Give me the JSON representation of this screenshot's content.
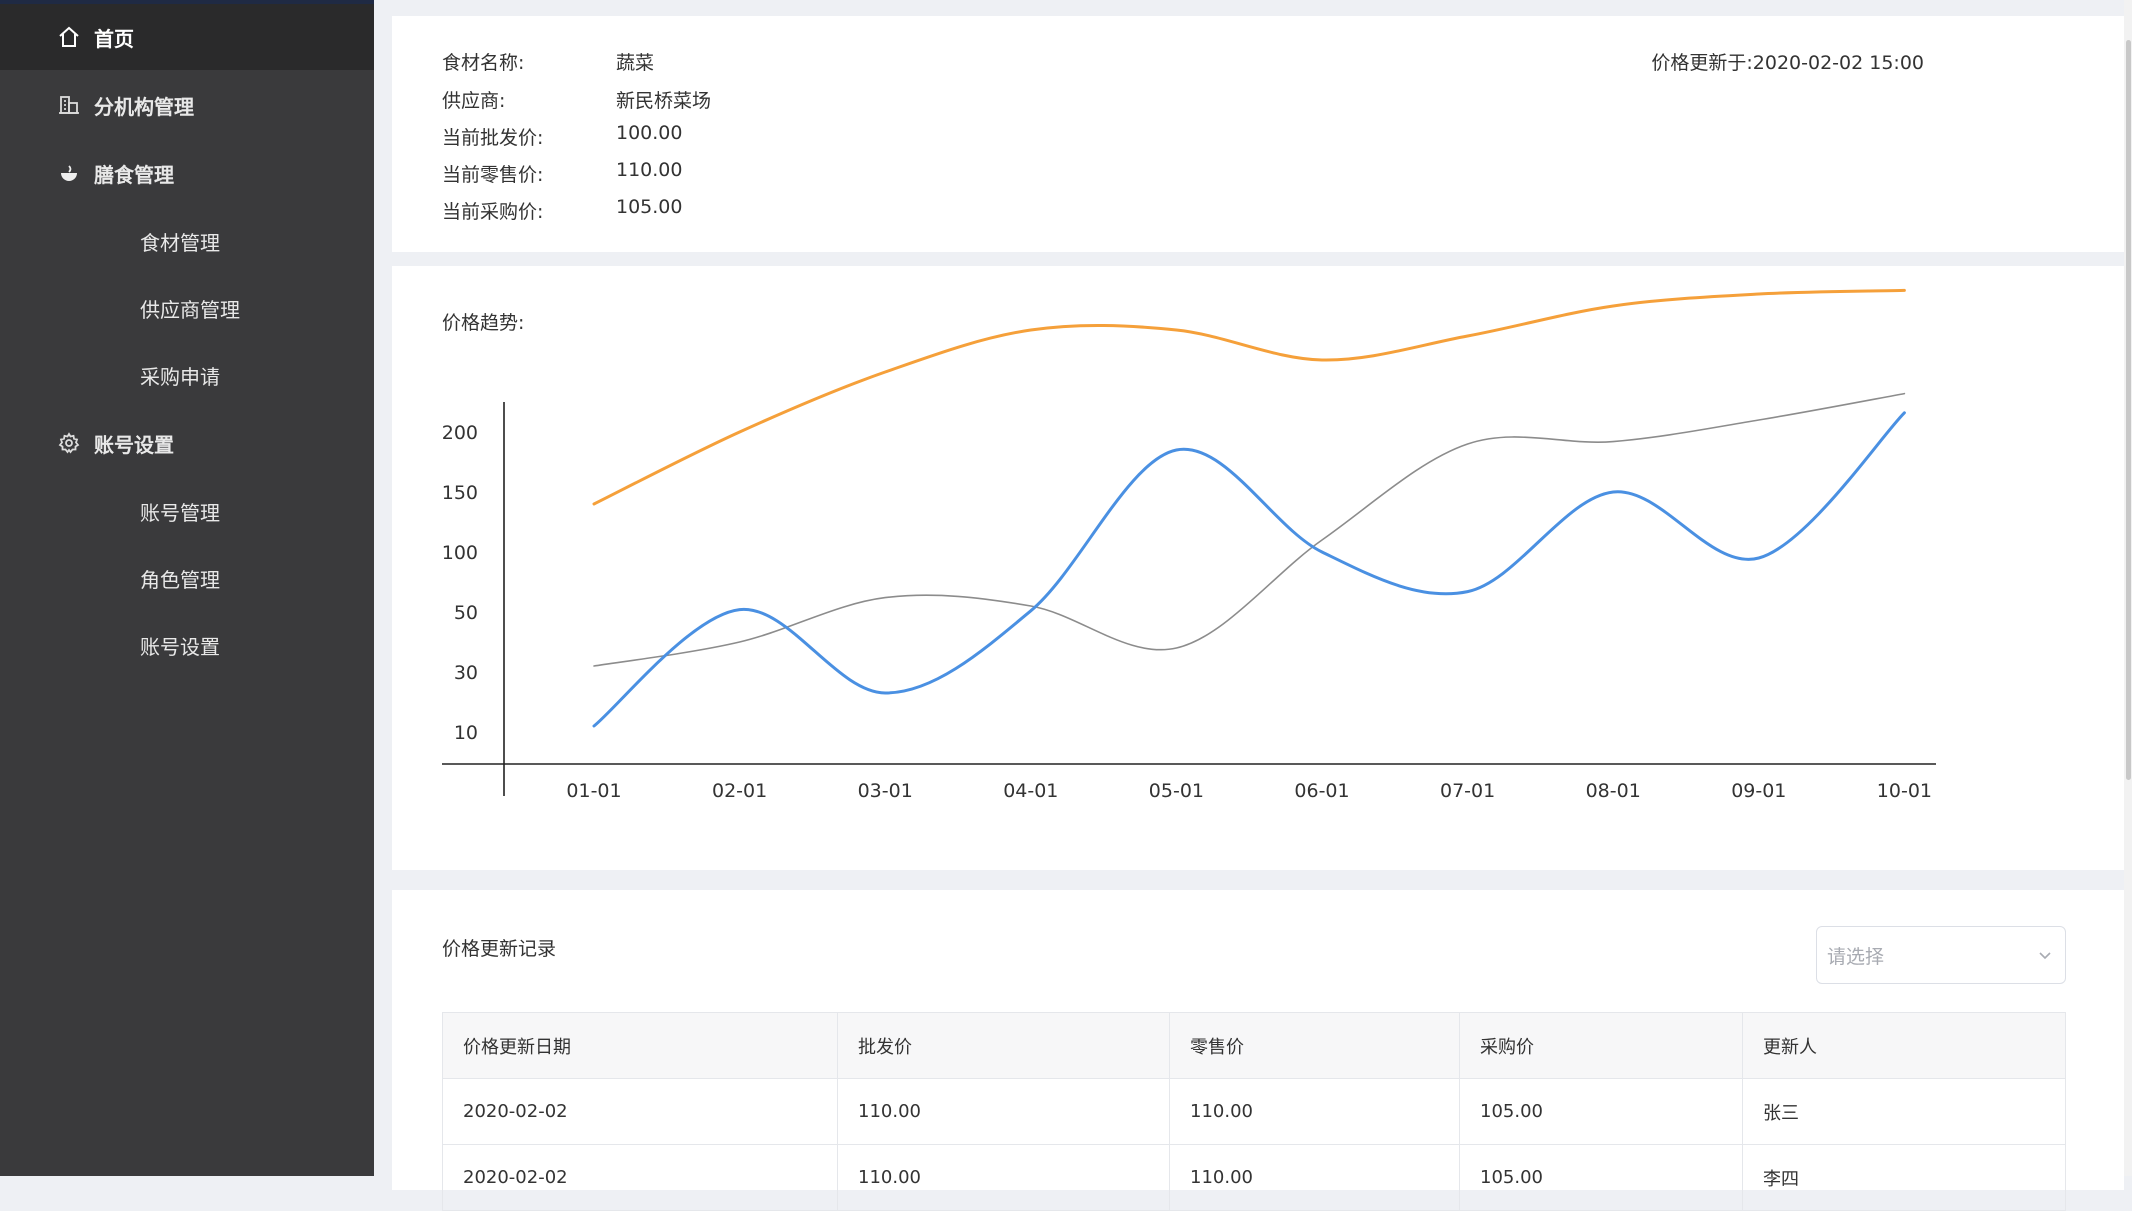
{
  "sidebar": {
    "items": [
      {
        "label": "首页",
        "icon": "home-icon",
        "active": true
      },
      {
        "label": "分机构管理",
        "icon": "building-icon"
      },
      {
        "label": "膳食管理",
        "icon": "food-icon"
      },
      {
        "label": "食材管理"
      },
      {
        "label": "供应商管理"
      },
      {
        "label": "采购申请"
      },
      {
        "label": "账号设置",
        "icon": "gear-icon"
      },
      {
        "label": "账号管理"
      },
      {
        "label": "角色管理"
      },
      {
        "label": "账号设置"
      }
    ]
  },
  "info": {
    "name_label": "食材名称:",
    "name_value": "蔬菜",
    "supplier_label": "供应商:",
    "supplier_value": "新民桥菜场",
    "wholesale_label": "当前批发价:",
    "wholesale_value": "100.00",
    "retail_label": "当前零售价:",
    "retail_value": "110.00",
    "purchase_label": "当前采购价:",
    "purchase_value": "105.00",
    "updated": "价格更新于:2020-02-02 15:00"
  },
  "chart_title": "价格趋势:",
  "chart_data": {
    "type": "line",
    "categories": [
      "01-01",
      "02-01",
      "03-01",
      "04-01",
      "05-01",
      "06-01",
      "07-01",
      "08-01",
      "09-01",
      "10-01"
    ],
    "y_ticks": [
      "10",
      "30",
      "50",
      "100",
      "150",
      "200"
    ],
    "series": [
      {
        "color": "#f5a03a",
        "values": [
          140,
          200,
          250,
          285,
          285,
          260,
          280,
          305,
          315,
          318
        ]
      },
      {
        "color": "#8c8c8c",
        "values": [
          32,
          40,
          62,
          55,
          38,
          110,
          190,
          192,
          210,
          232
        ]
      },
      {
        "color": "#4a90e2",
        "values": [
          12,
          52,
          23,
          51,
          185,
          100,
          67,
          150,
          95,
          216
        ]
      }
    ]
  },
  "records": {
    "title": "价格更新记录",
    "select_placeholder": "请选择",
    "headers": [
      "价格更新日期",
      "批发价",
      "零售价",
      "采购价",
      "更新人"
    ],
    "rows": [
      [
        "2020-02-02",
        "110.00",
        "110.00",
        "105.00",
        "张三"
      ],
      [
        "2020-02-02",
        "110.00",
        "110.00",
        "105.00",
        "李四"
      ]
    ]
  }
}
